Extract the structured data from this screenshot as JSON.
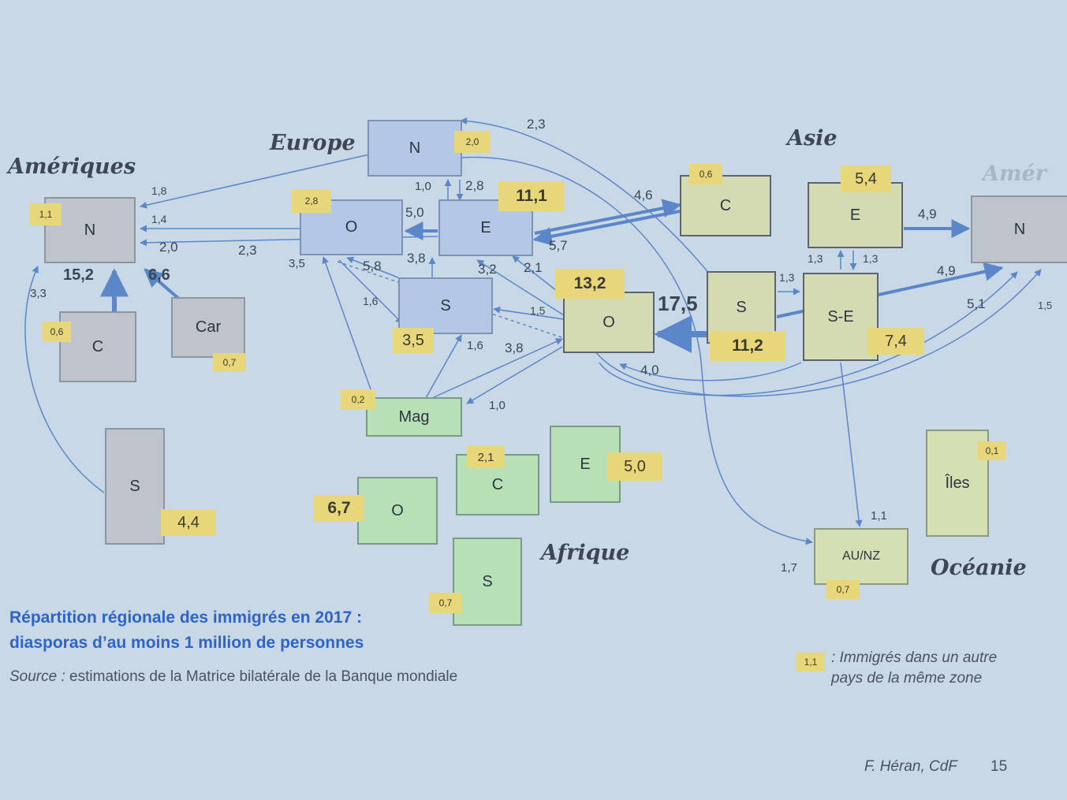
{
  "regions": {
    "americas": "Amériques",
    "americas_right": "Amér",
    "europe": "Europe",
    "asia": "Asie",
    "africa": "Afrique",
    "oceania": "Océanie"
  },
  "nodes": {
    "am_n": "N",
    "am_c": "C",
    "am_car": "Car",
    "am_s": "S",
    "eu_n": "N",
    "eu_o": "O",
    "eu_e": "E",
    "eu_s": "S",
    "as_c": "C",
    "as_e": "E",
    "as_s": "S",
    "as_se": "S-E",
    "as_o": "O",
    "amr_n": "N",
    "af_mag": "Mag",
    "af_o": "O",
    "af_c": "C",
    "af_e": "E",
    "af_s": "S",
    "oc_iles": "Îles",
    "oc_aunz": "AU/NZ"
  },
  "intra": {
    "am_n": "1,1",
    "am_c": "0,6",
    "am_car": "0,7",
    "am_s": "4,4",
    "eu_n": "2,0",
    "eu_o": "2,8",
    "eu_e": "11,1",
    "eu_s": "3,5",
    "as_c": "0,6",
    "as_e": "5,4",
    "as_s": "11,2",
    "as_se": "7,4",
    "as_o": "13,2",
    "af_mag": "0,2",
    "af_o": "6,7",
    "af_c": "2,1",
    "af_e": "5,0",
    "af_s": "0,7",
    "oc_iles": "0,1",
    "oc_aunz": "0,7"
  },
  "flows": {
    "f_2_3_top": "2,3",
    "f_1_8": "1,8",
    "f_1_4": "1,4",
    "f_2_0": "2,0",
    "f_2_3": "2,3",
    "f_3_3": "3,3",
    "f_15_2": "15,2",
    "f_6_6": "6,6",
    "f_1_0": "1,0",
    "f_2_8": "2,8",
    "f_5_0": "5,0",
    "f_3_5": "3,5",
    "f_5_8": "5,8",
    "f_3_8": "3,8",
    "f_3_2": "3,2",
    "f_2_1": "2,1",
    "f_1_6a": "1,6",
    "f_1_5": "1,5",
    "f_1_6b": "1,6",
    "f_3_8b": "3,8",
    "f_1_0b": "1,0",
    "f_4_6": "4,6",
    "f_5_7": "5,7",
    "f_17_5": "17,5",
    "f_4_0": "4,0",
    "f_4_9a": "4,9",
    "f_1_3a": "1,3",
    "f_1_3b": "1,3",
    "f_1_3c": "1,3",
    "f_4_9b": "4,9",
    "f_5_1": "5,1",
    "f_1_5b": "1,5",
    "f_1_1": "1,1",
    "f_1_7": "1,7"
  },
  "caption": {
    "line1": "Répartition régionale des immigrés en 2017 :",
    "line2": "diasporas  d’au moins 1 million de personnes",
    "source_label": "Source :",
    "source_text": " estimations de la Matrice bilatérale de la Banque mondiale"
  },
  "legend": {
    "sample": "1,1",
    "line1": ": Immigrés dans un autre",
    "line2": "pays de la même zone"
  },
  "credit": {
    "author": "F. Héran, CdF",
    "page": "15"
  },
  "colors": {
    "background": "#c9d8e6",
    "arrow": "#5b87c9",
    "americas": "#bfc3cb",
    "europe": "#b3c8e6",
    "asia": "#d4dbb3",
    "africa": "#b7e0b7",
    "tag": "#e8d67a",
    "caption": "#2e64c8"
  }
}
